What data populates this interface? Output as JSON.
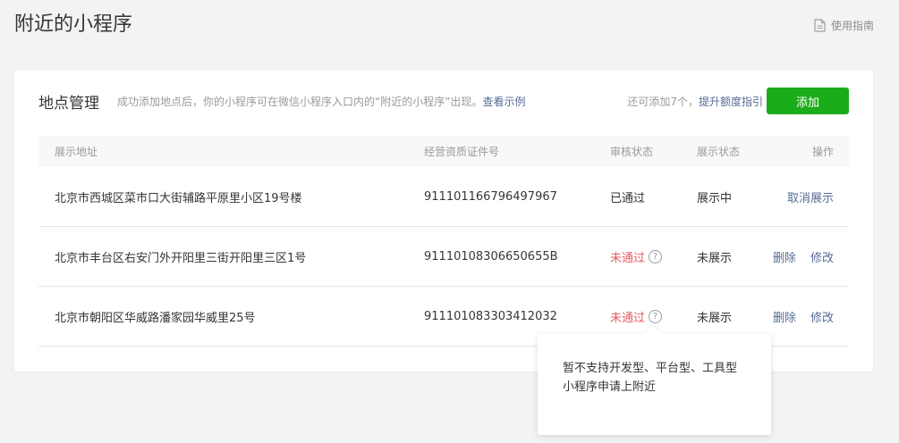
{
  "header": {
    "title": "附近的小程序",
    "guide_link": "使用指南",
    "guide_icon": "document-icon"
  },
  "section": {
    "title": "地点管理",
    "hint": "成功添加地点后，你的小程序可在微信小程序入口内的“附近的小程序”出现。",
    "example_link": "查看示例",
    "quota_text": "还可添加7个，",
    "raise_quota_link": "提升额度指引",
    "add_button": "添加",
    "brand_color": "#1aad19"
  },
  "table": {
    "headers": {
      "address": "展示地址",
      "license": "经营资质证件号",
      "audit": "审核状态",
      "display": "展示状态",
      "ops": "操作"
    },
    "rows": [
      {
        "address": "北京市西城区菜市口大街辅路平原里小区19号楼",
        "license": "911101166796497967",
        "audit": "已通过",
        "display": "展示中",
        "op1": "取消展示"
      },
      {
        "address": "北京市丰台区右安门外开阳里三街开阳里三区1号",
        "license": "91110108306650655B",
        "audit": "未通过",
        "display": "未展示",
        "op1": "删除",
        "op2": "修改"
      },
      {
        "address": "北京市朝阳区华威路潘家园华威里25号",
        "license": "911101083303412032",
        "audit": "未通过",
        "display": "未展示",
        "op1": "删除",
        "op2": "修改"
      }
    ],
    "help_glyph": "?"
  },
  "tooltip": {
    "text": "暂不支持开发型、平台型、工具型小程序申请上附近"
  }
}
